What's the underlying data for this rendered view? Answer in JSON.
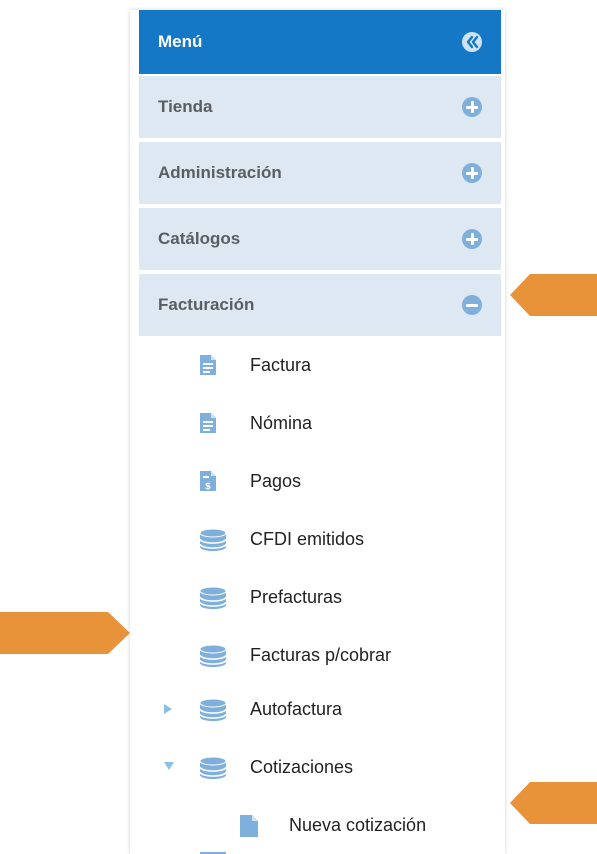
{
  "menu": {
    "title": "Menú",
    "sections": [
      {
        "label": "Tienda",
        "state": "collapsed"
      },
      {
        "label": "Administración",
        "state": "collapsed"
      },
      {
        "label": "Catálogos",
        "state": "collapsed"
      },
      {
        "label": "Facturación",
        "state": "expanded"
      }
    ],
    "facturacion_items": [
      {
        "label": "Factura",
        "icon": "document-icon"
      },
      {
        "label": "Nómina",
        "icon": "document-icon"
      },
      {
        "label": "Pagos",
        "icon": "payment-document-icon"
      },
      {
        "label": "CFDI emitidos",
        "icon": "database-icon"
      },
      {
        "label": "Prefacturas",
        "icon": "database-icon"
      },
      {
        "label": "Facturas p/cobrar",
        "icon": "database-icon"
      },
      {
        "label": "Autofactura",
        "icon": "database-icon",
        "toggle": "collapsed"
      },
      {
        "label": "Cotizaciones",
        "icon": "database-icon",
        "toggle": "expanded"
      }
    ],
    "cotizaciones_items": [
      {
        "label": "Nueva cotización",
        "icon": "file-icon"
      }
    ]
  },
  "colors": {
    "header": "#1578c7",
    "section_bg": "#dde8f2",
    "icon_blue": "#7fb0dc",
    "pointer": "#e8923a"
  }
}
